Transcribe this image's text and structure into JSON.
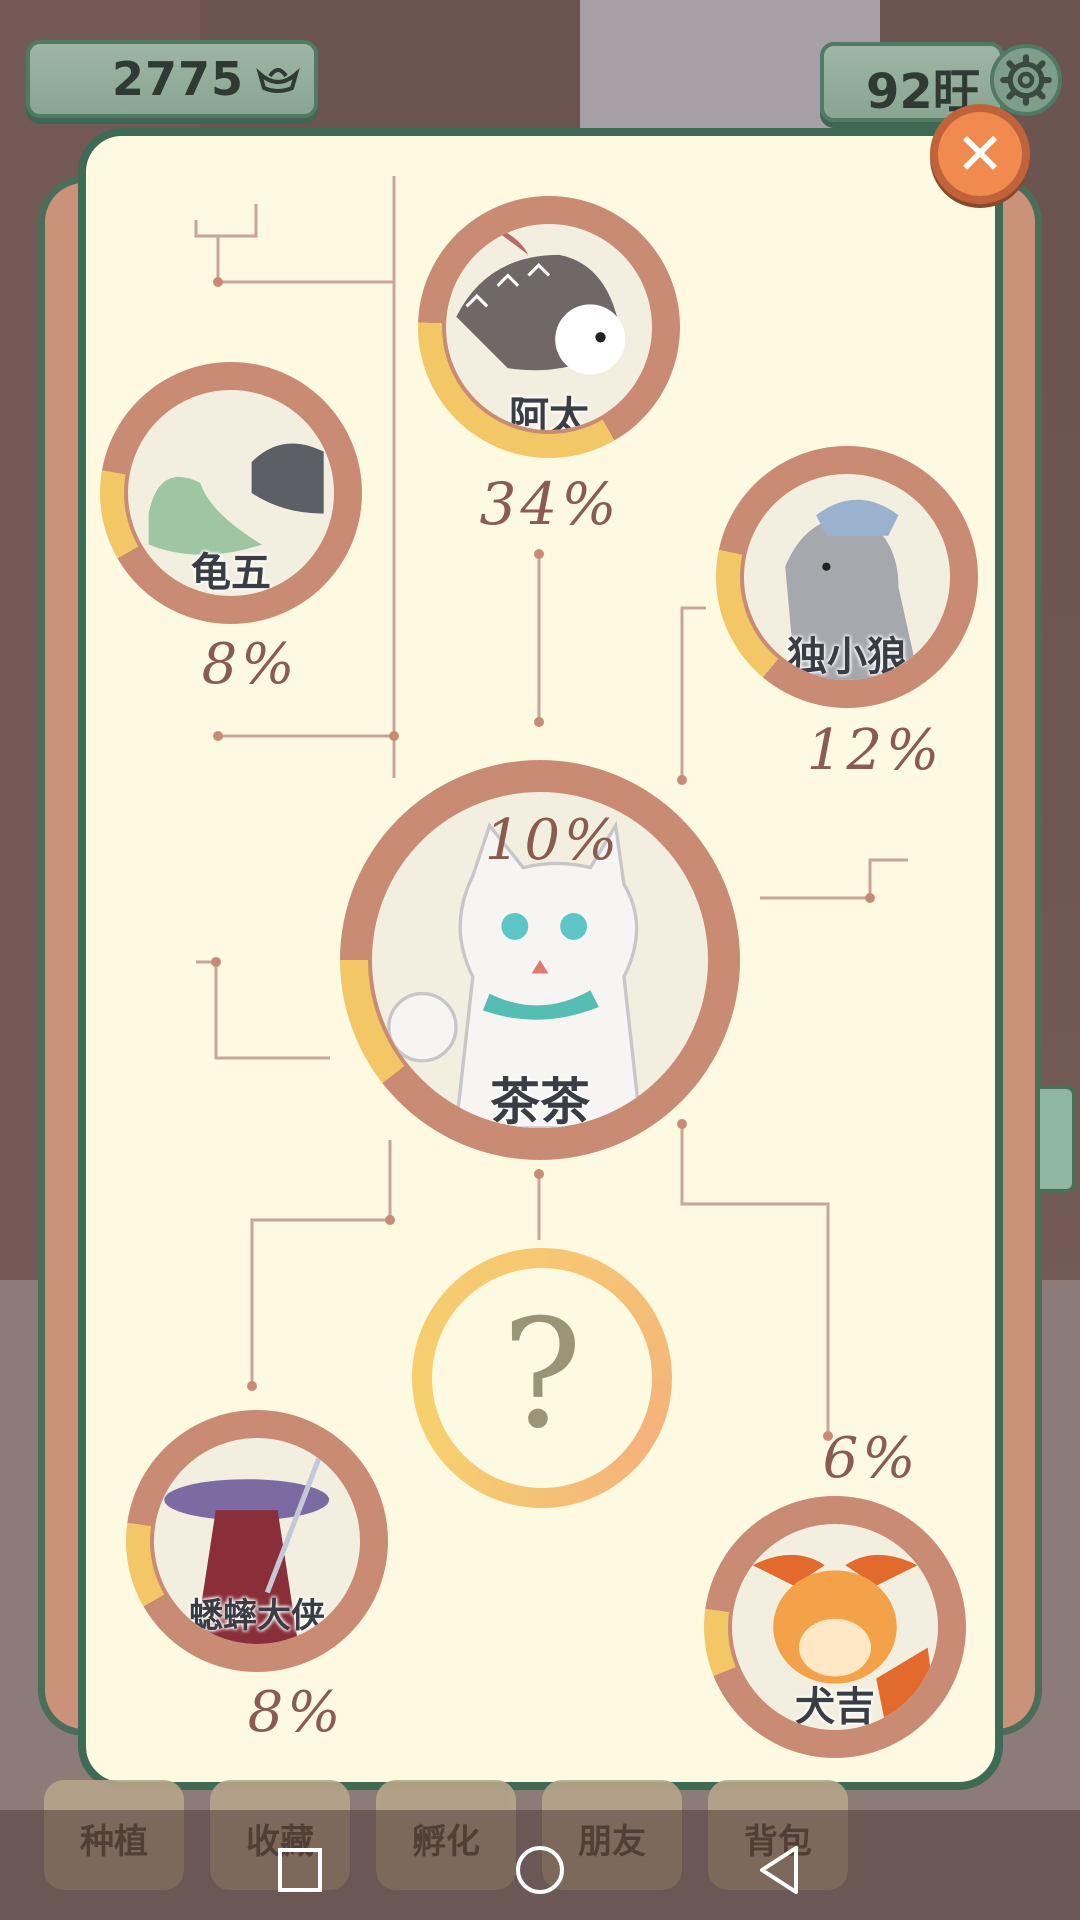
{
  "hud": {
    "coins": "2775",
    "coin_icon": "ingot-icon",
    "energy": "92旺",
    "settings_icon": "gear-icon"
  },
  "dialog": {
    "close_icon": "close-icon",
    "center": {
      "name": "茶茶",
      "percent": "10%"
    },
    "characters": [
      {
        "name": "阿太",
        "percent": "34%"
      },
      {
        "name": "龟五",
        "percent": "8%"
      },
      {
        "name": "独小狼",
        "percent": "12%"
      },
      {
        "name": "蟋蟀大侠",
        "percent": "8%"
      },
      {
        "name": "犬吉",
        "percent": "6%"
      }
    ],
    "mystery": "?"
  },
  "bottom_tabs": [
    "种植",
    "收藏",
    "孵化",
    "朋友",
    "背包"
  ],
  "system_nav": [
    "square-icon",
    "circle-icon",
    "back-triangle-icon"
  ],
  "colors": {
    "panel": "#fdfae1",
    "ring": "#c98b73",
    "progress": "#f3c766",
    "frame": "#3f6a55",
    "close": "#f08a4f"
  }
}
